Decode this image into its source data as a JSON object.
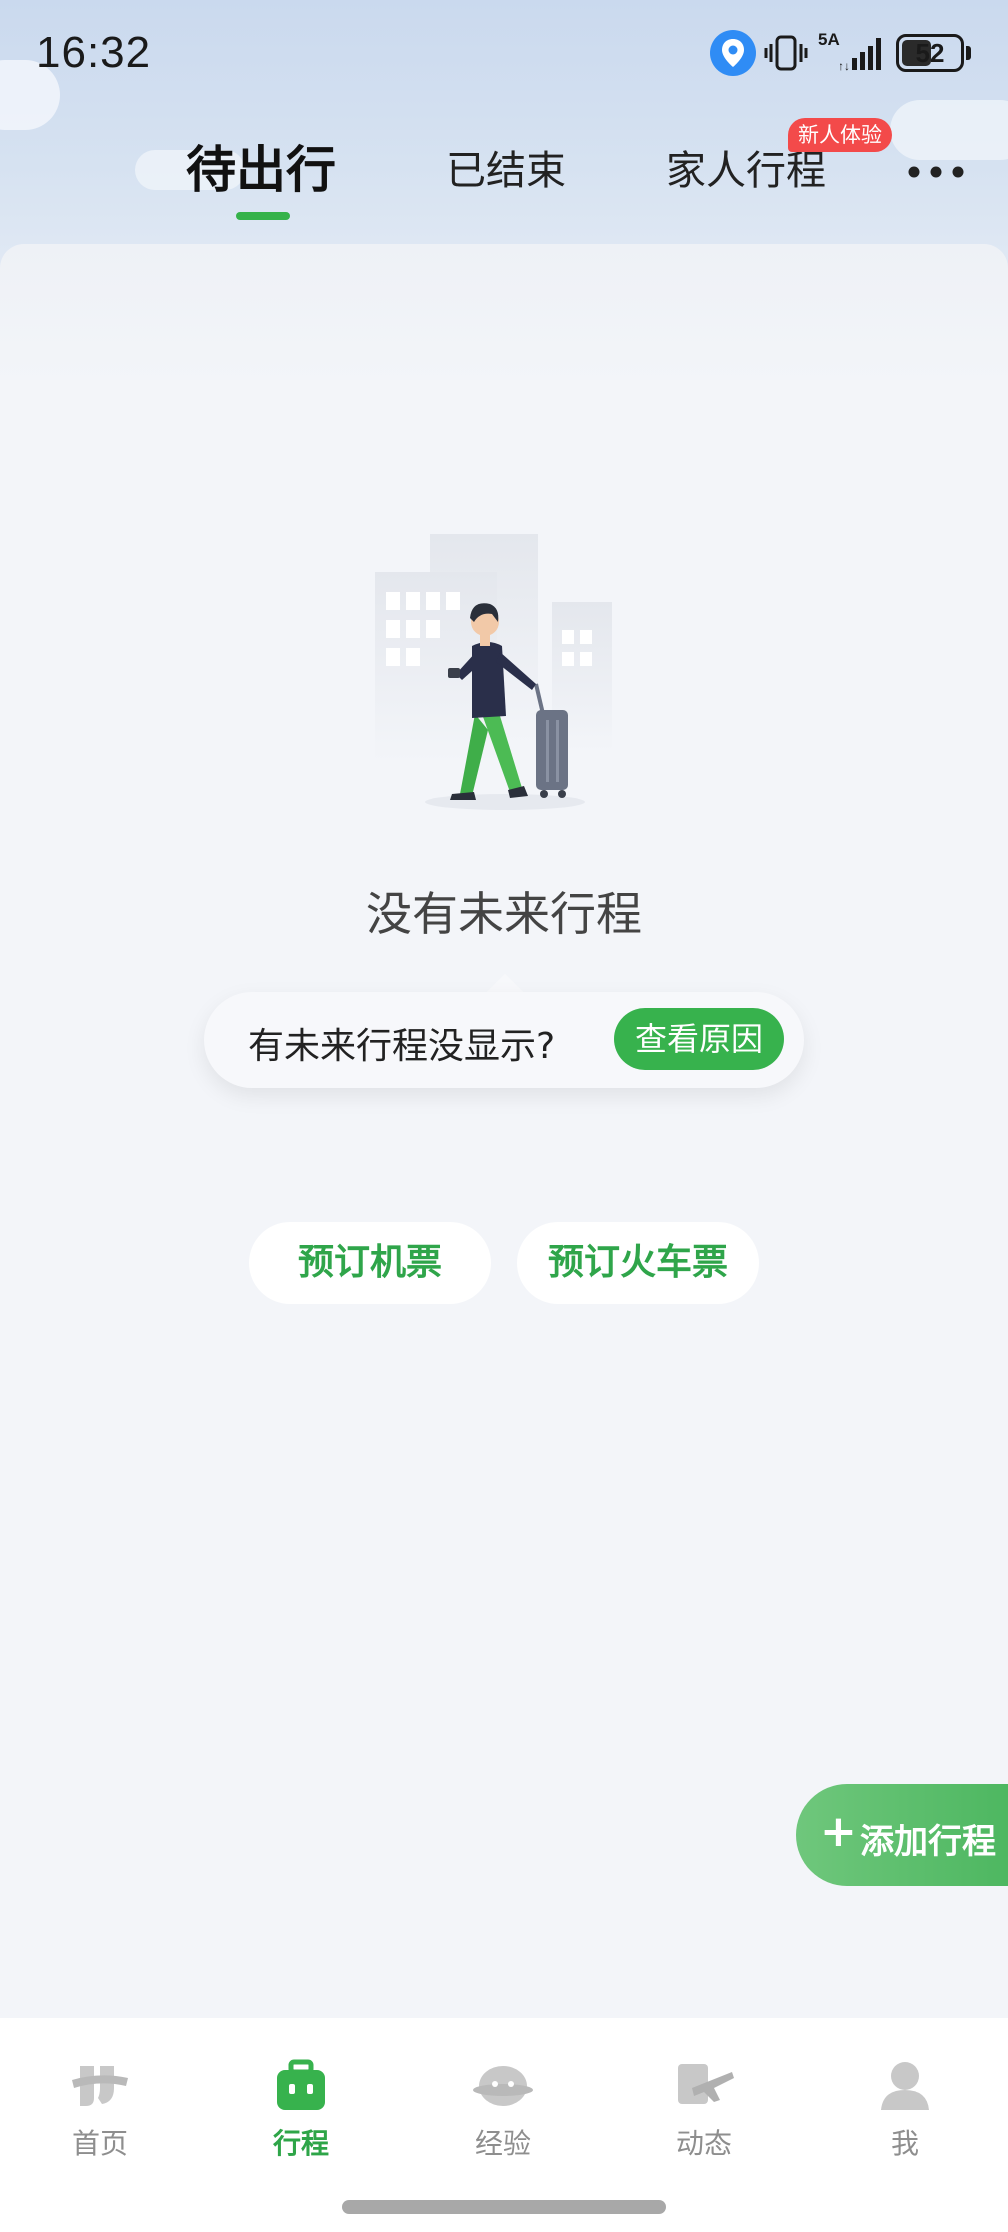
{
  "status_bar": {
    "time": "16:32",
    "network": "5A",
    "battery": "52",
    "battery_level": 0.52,
    "icons": [
      "location-icon",
      "vibrate-icon",
      "signal-icon",
      "battery-icon"
    ]
  },
  "tabs": {
    "items": [
      {
        "label": "待出行",
        "active": true
      },
      {
        "label": "已结束",
        "active": false
      },
      {
        "label": "家人行程",
        "active": false
      }
    ],
    "badge": "新人体验",
    "more_icon": "more-dots-icon"
  },
  "empty_state": {
    "illustration": "traveler-with-luggage-illustration",
    "title": "没有未来行程",
    "tip_text": "有未来行程没显示?",
    "tip_button": "查看原因"
  },
  "actions": {
    "book_flight": "预订机票",
    "book_train": "预订火车票"
  },
  "fab": {
    "plus": "+",
    "label": "添加行程"
  },
  "bottom_nav": {
    "items": [
      {
        "label": "首页",
        "icon": "home-icon",
        "active": false
      },
      {
        "label": "行程",
        "icon": "trip-briefcase-icon",
        "active": true
      },
      {
        "label": "经验",
        "icon": "experience-bubble-icon",
        "active": false
      },
      {
        "label": "动态",
        "icon": "flight-status-icon",
        "active": false
      },
      {
        "label": "我",
        "icon": "profile-icon",
        "active": false
      }
    ]
  },
  "colors": {
    "accent_green": "#37b24d",
    "badge_red": "#f34a4a",
    "sky": "#cad9ee",
    "page_bg": "#f3f5f9"
  }
}
